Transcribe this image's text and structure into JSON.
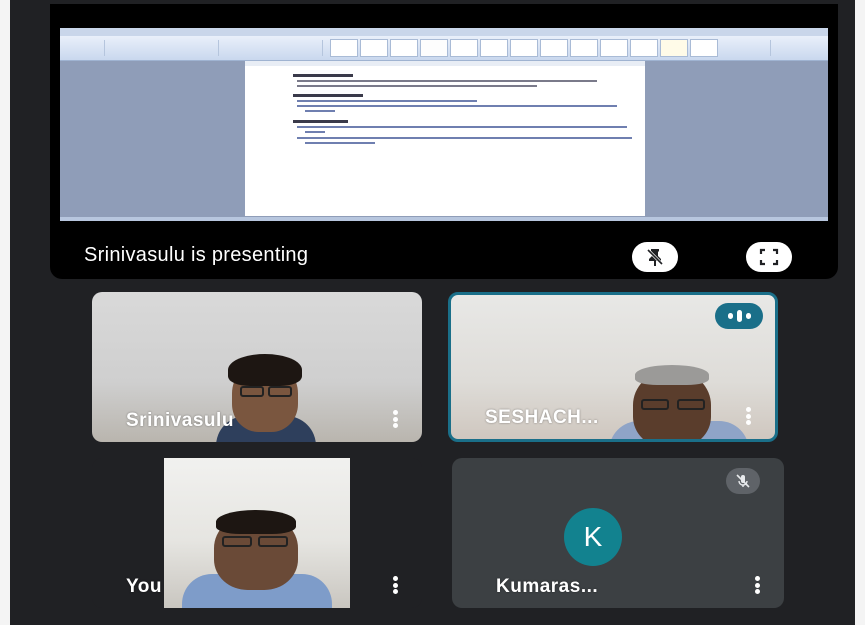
{
  "presentation": {
    "label": "Srinivasulu is presenting",
    "buttons": {
      "pin_icon": "pin-off-icon",
      "fullscreen_icon": "fullscreen-icon"
    }
  },
  "participants": [
    {
      "name": "Srinivasulu",
      "video": true,
      "speaking": false
    },
    {
      "name": "SESHACH...",
      "video": true,
      "speaking": true
    },
    {
      "name": "You",
      "video": true,
      "speaking": false
    },
    {
      "name": "Kumaras...",
      "video": false,
      "avatar_letter": "K",
      "muted": true
    }
  ],
  "colors": {
    "accent": "#1a6f89",
    "avatar_bg": "#12828f",
    "tile_bg": "#3c4043",
    "background": "#202124"
  }
}
